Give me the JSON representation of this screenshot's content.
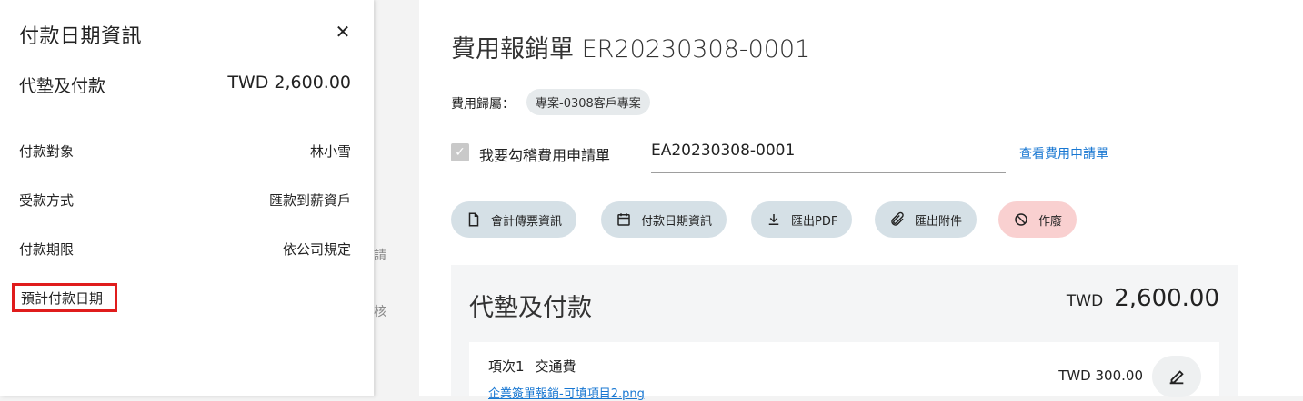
{
  "drawer": {
    "title": "付款日期資訊",
    "close_icon": "close-icon",
    "total_label": "代墊及付款",
    "total_value": "TWD 2,600.00",
    "rows": [
      {
        "label": "付款對象",
        "value": "林小雪"
      },
      {
        "label": "受款方式",
        "value": "匯款到薪資戶"
      },
      {
        "label": "付款期限",
        "value": "依公司規定"
      }
    ],
    "highlight_label": "預計付款日期"
  },
  "behind": {
    "text_1": "請",
    "text_2": "核"
  },
  "main": {
    "title": "費用報銷單 ER20230308-0001",
    "category_label": "費用歸屬：",
    "category_chip": "專案-0308客戶專案",
    "checkbox_label": "我要勾稽費用申請單",
    "request_no": "EA20230308-0001",
    "view_request_link": "查看費用申請單",
    "buttons": {
      "voucher": "會計傳票資訊",
      "payment_date": "付款日期資訊",
      "export_pdf": "匯出PDF",
      "export_attach": "匯出附件",
      "void": "作廢"
    }
  },
  "card": {
    "title": "代墊及付款",
    "currency": "TWD",
    "amount": "2,600.00",
    "item": {
      "index": "項次1",
      "type": "交通費",
      "file": "企業簽單報銷-可填項目2.png",
      "amount": "TWD 300.00"
    }
  },
  "colors": {
    "highlight_border": "#e01c1c",
    "link": "#1877d2",
    "button_bg": "#d5e0e6",
    "danger_bg": "#f9d0d0"
  }
}
